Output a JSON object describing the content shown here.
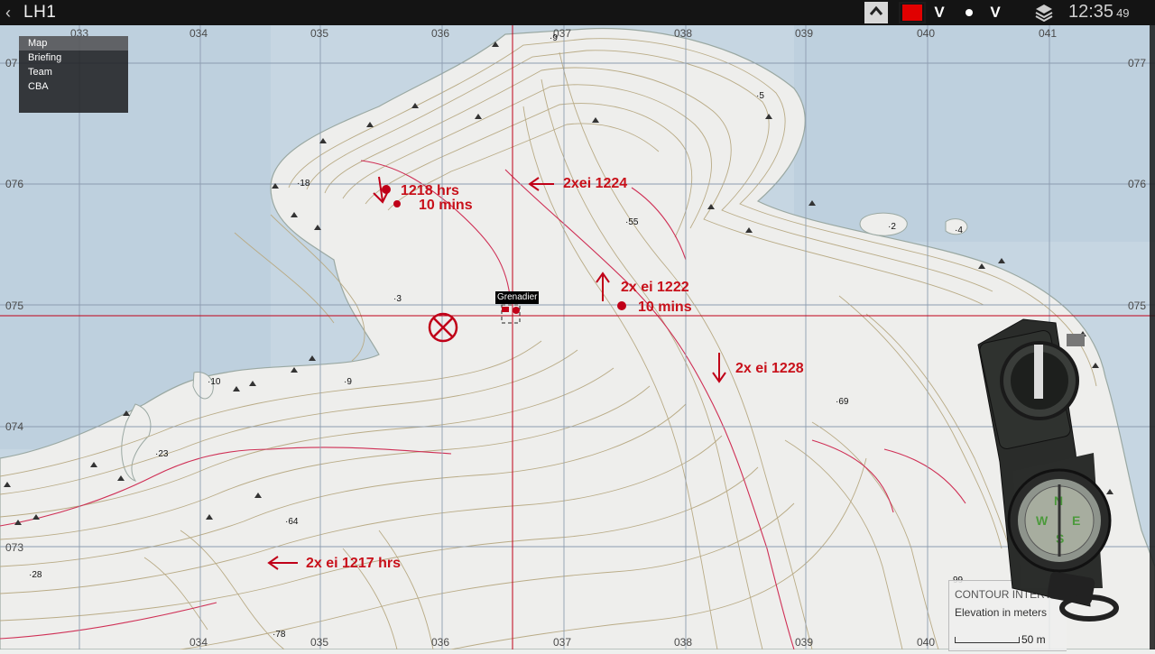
{
  "topbar": {
    "back_glyph": "‹",
    "title": "LH1",
    "marker_color": "#e00000",
    "chevron_glyph": "V",
    "time_main": "12:35",
    "time_seconds": "49"
  },
  "menu": {
    "items": [
      "Map",
      "Briefing",
      "Team",
      "CBA"
    ],
    "selected": "Map"
  },
  "grid": {
    "x_labels": [
      "033",
      "034",
      "035",
      "036",
      "037",
      "038",
      "039",
      "040",
      "041"
    ],
    "y_labels": [
      "077",
      "076",
      "075",
      "074",
      "073"
    ],
    "x_labels_short": [
      "033",
      "034",
      "035",
      "036",
      "037",
      "038",
      "039",
      "040",
      "041"
    ],
    "y_labels_left": [
      "07",
      "076",
      "075",
      "074",
      "073"
    ]
  },
  "markers": {
    "m1_line1": "1218 hrs",
    "m1_line2": "10 mins",
    "m2": "2xei 1224",
    "m3_line1": "2x ei 1222",
    "m3_line2": "10 mins",
    "m4": "2x ei 1228",
    "m5": "2x ei 1217 hrs",
    "color": "#c8101a"
  },
  "heights": [
    "9",
    "5",
    "18",
    "55",
    "2",
    "4",
    "3",
    "10",
    "9",
    "69",
    "23",
    "64",
    "28",
    "78",
    "99"
  ],
  "unit": {
    "label": "Grenadier"
  },
  "legend": {
    "title": "CONTOUR INTERV",
    "subtitle": "Elevation in meters",
    "scale": "50 m"
  },
  "colors": {
    "sea": "#c4d4e0",
    "land": "#eeeeec",
    "contour": "#b9ab86",
    "index_contour": "#cf2f55",
    "grid": "#8c9cb0",
    "crosshair": "#c00018"
  }
}
